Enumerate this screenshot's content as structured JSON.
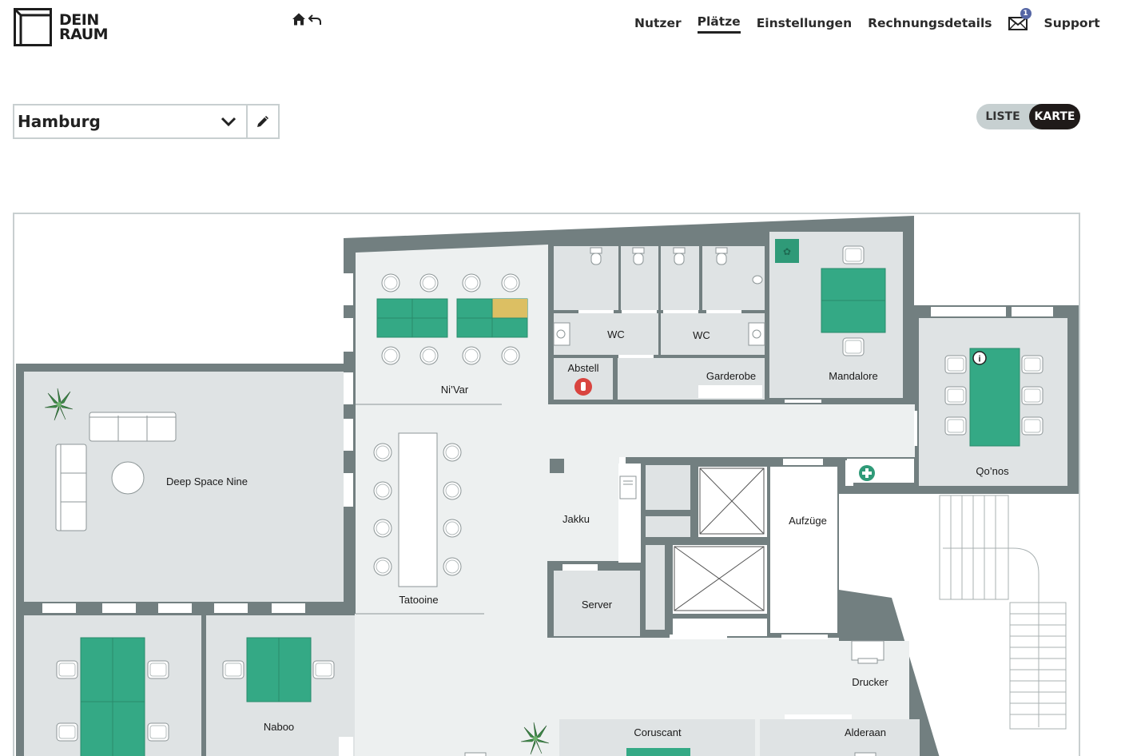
{
  "brand": {
    "line1": "DEIN",
    "line2": "RAUM"
  },
  "header": {
    "home_icon": "home-icon",
    "back_icon": "back-arrow-icon",
    "nav": [
      {
        "label": "Nutzer",
        "active": false
      },
      {
        "label": "Plätze",
        "active": true
      },
      {
        "label": "Einstellungen",
        "active": false
      },
      {
        "label": "Rechnungsdetails",
        "active": false
      }
    ],
    "mail": {
      "icon": "mail-icon",
      "badge": "1"
    },
    "support_label": "Support"
  },
  "location": {
    "selected": "Hamburg",
    "dropdown_icon": "chevron-down-icon",
    "edit_icon": "pencil-icon"
  },
  "view_toggle": {
    "list_label": "LISTE",
    "map_label": "KARTE",
    "active": "KARTE"
  },
  "colors": {
    "desk_free": "#34a985",
    "desk_occupied": "#dcbf63",
    "wall": "#727f80",
    "room_floor": "#dfe3e4",
    "corridor": "#edf0f0"
  },
  "rooms": {
    "nivar": "Ni’Var",
    "wc1": "WC",
    "wc2": "WC",
    "abstell": "Abstell",
    "garderobe": "Garderobe",
    "mandalore": "Mandalore",
    "qonos": "Qo’nos",
    "deep_space_nine": "Deep Space Nine",
    "tatooine": "Tatooine",
    "jakku": "Jakku",
    "aufzuege": "Aufzüge",
    "server": "Server",
    "drucker": "Drucker",
    "naboo": "Naboo",
    "coruscant": "Coruscant",
    "alderaan": "Alderaan"
  }
}
